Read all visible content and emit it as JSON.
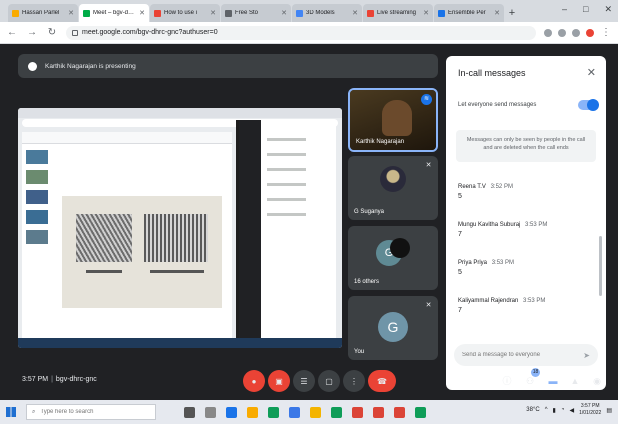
{
  "browser": {
    "tabs": [
      {
        "title": "Hassan Parlel",
        "active": false,
        "color": "#f9ab00"
      },
      {
        "title": "Meet – bgv-dhrc",
        "active": true,
        "color": "#00ac47"
      },
      {
        "title": "How to use i",
        "active": false,
        "color": "#ea4335"
      },
      {
        "title": "Free Sto",
        "active": false,
        "color": "#5f6368"
      },
      {
        "title": "3D Models",
        "active": false,
        "color": "#4285f4"
      },
      {
        "title": "Live streaming",
        "active": false,
        "color": "#ea4335"
      },
      {
        "title": "Ensemble Per",
        "active": false,
        "color": "#1a73e8"
      }
    ],
    "new_tab": "+",
    "window_controls": [
      "–",
      "□",
      "✕"
    ],
    "url": "meet.google.com/bgv-dhrc-gnc?authuser=0"
  },
  "meet": {
    "presenting_banner": "Karthik Nagarajan is presenting",
    "participants": [
      {
        "name": "Karthik Nagarajan",
        "type": "video"
      },
      {
        "name": "G Suganya",
        "type": "photo"
      },
      {
        "name": "16 others",
        "type": "group",
        "initial": "G"
      },
      {
        "name": "You",
        "type": "self",
        "initial": "G"
      }
    ],
    "bottom_bar": {
      "time": "3:57 PM",
      "separator": "|",
      "meeting_code": "bgv-dhrc-gnc",
      "badge_count": "18"
    }
  },
  "panel": {
    "title": "In-call messages",
    "close": "✕",
    "toggle_label": "Let everyone send messages",
    "notice": "Messages can only be seen by people in the call and are deleted when the call ends",
    "messages": [
      {
        "sender": "Reena T.V",
        "time": "3:52 PM",
        "text": "5"
      },
      {
        "sender": "Mungu Kavitha Suburaj",
        "time": "3:53 PM",
        "text": "7"
      },
      {
        "sender": "Priya Priya",
        "time": "3:53 PM",
        "text": "5"
      },
      {
        "sender": "Kaliyammal Rajendran",
        "time": "3:53 PM",
        "text": "7"
      }
    ],
    "compose_placeholder": "Send a message to everyone",
    "send_icon": "➤"
  },
  "taskbar": {
    "search_placeholder": "Type here to search",
    "weather": "38°C",
    "time": "3:57 PM",
    "date": "1/01/2022"
  },
  "colors": {
    "meet_bg": "#202124",
    "tile_bg": "#3c4043",
    "accent": "#1a73e8",
    "danger": "#ea4335"
  }
}
